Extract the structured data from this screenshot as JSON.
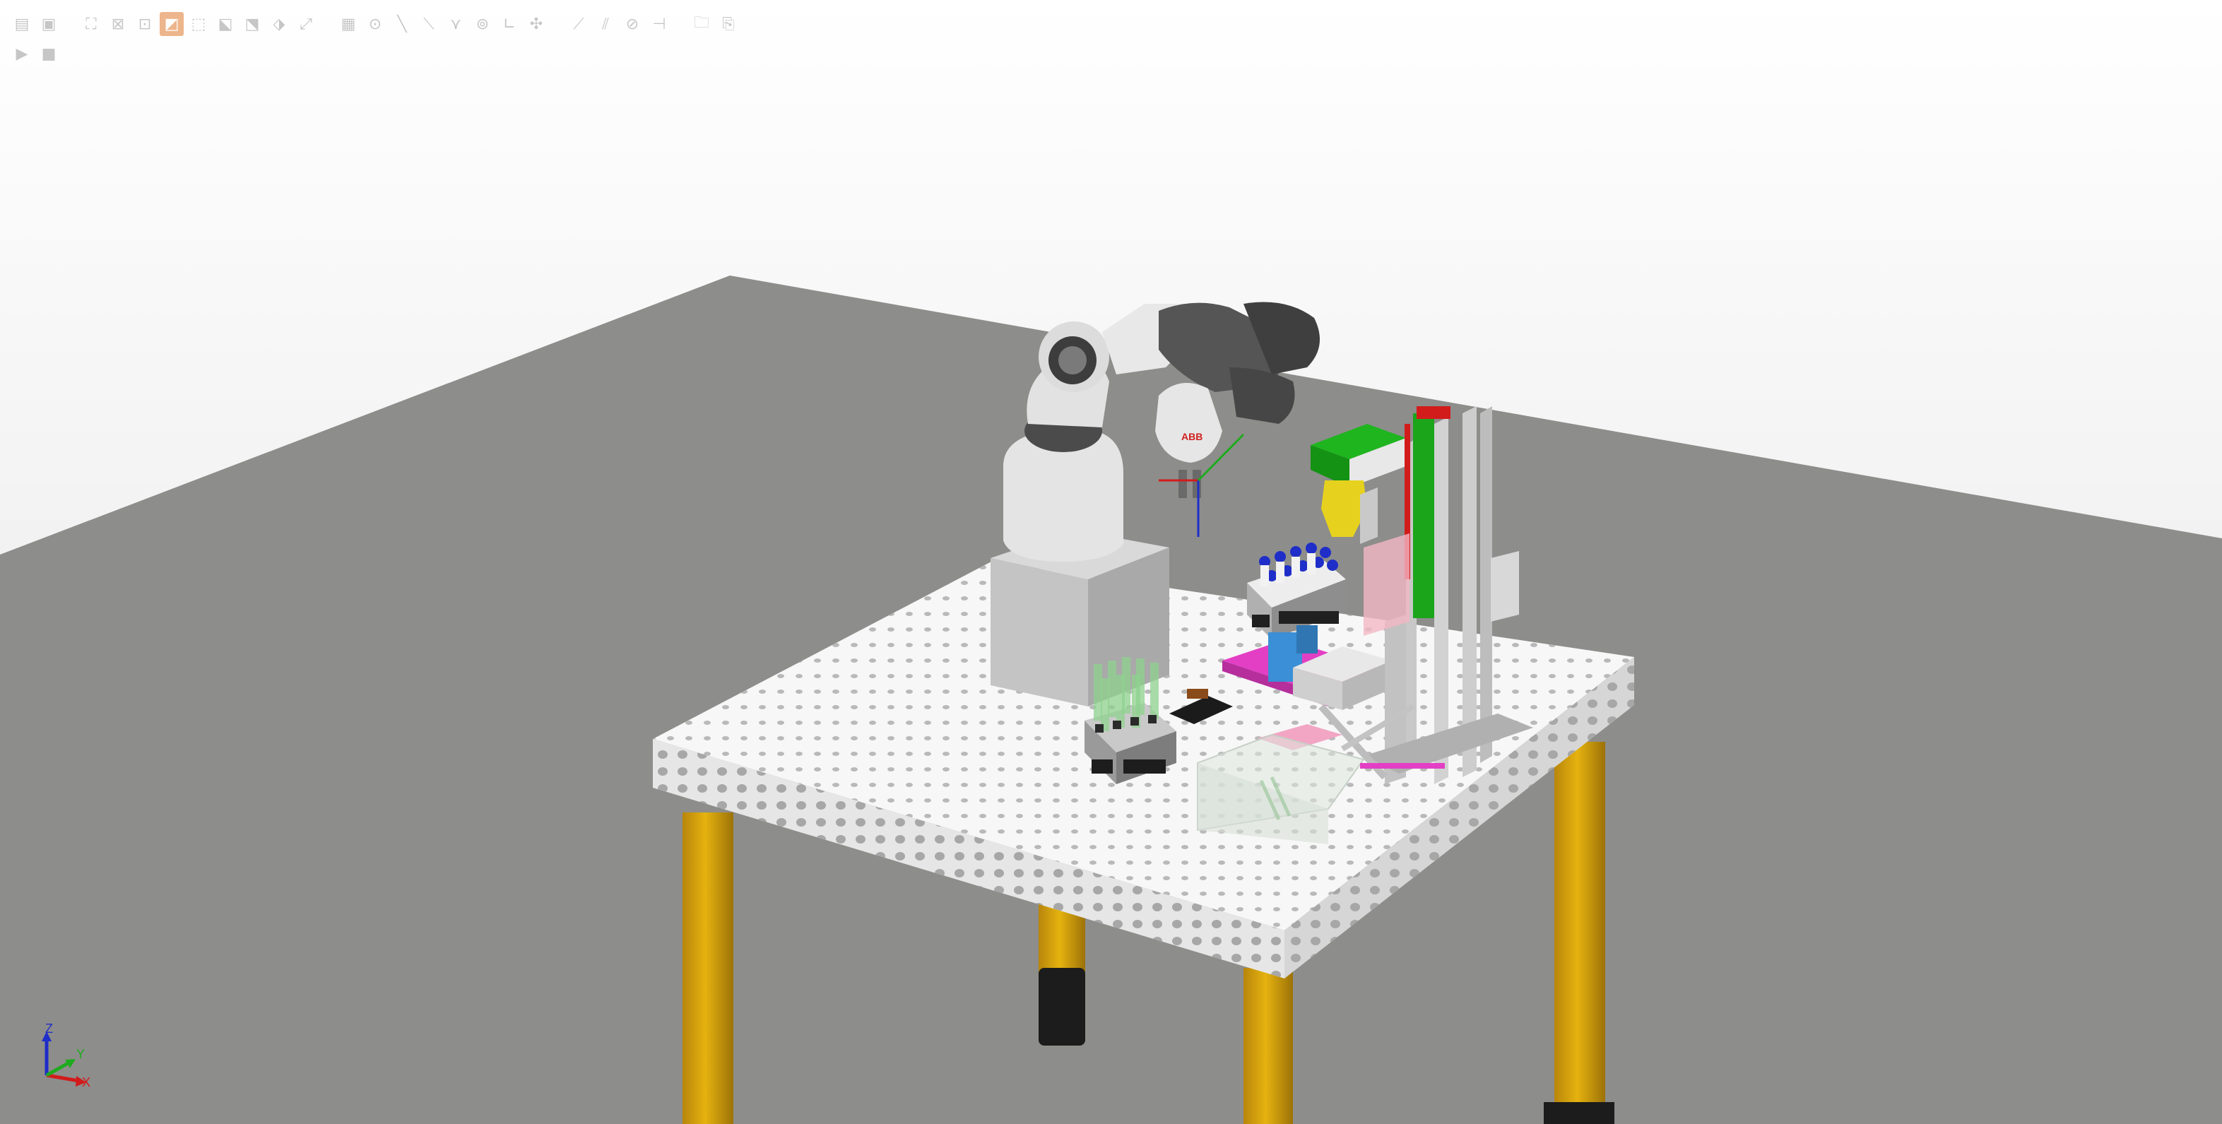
{
  "toolbar": {
    "row1": [
      {
        "icon": "new-file-icon",
        "glyph": "▤"
      },
      {
        "icon": "open-file-icon",
        "glyph": "▣"
      },
      {
        "icon": "zoom-fit-icon",
        "glyph": "⛶"
      },
      {
        "icon": "zoom-window-icon",
        "glyph": "⊠"
      },
      {
        "icon": "zoom-selection-icon",
        "glyph": "⊡"
      },
      {
        "icon": "render-mode-icon",
        "glyph": "◩",
        "active": true
      },
      {
        "icon": "view-front-icon",
        "glyph": "⬚"
      },
      {
        "icon": "view-top-icon",
        "glyph": "⬕"
      },
      {
        "icon": "view-side-icon",
        "glyph": "⬔"
      },
      {
        "icon": "view-iso-icon",
        "glyph": "⬗"
      },
      {
        "icon": "view-custom-icon",
        "glyph": "⤢"
      },
      {
        "icon": "grid-icon",
        "glyph": "▦"
      },
      {
        "icon": "snap-point-icon",
        "glyph": "⊙"
      },
      {
        "icon": "snap-edge-icon",
        "glyph": "╲"
      },
      {
        "icon": "snap-line-icon",
        "glyph": "⟍"
      },
      {
        "icon": "snap-vertex-icon",
        "glyph": "⋎"
      },
      {
        "icon": "snap-center-icon",
        "glyph": "⊚"
      },
      {
        "icon": "measure-angle-icon",
        "glyph": "∟"
      },
      {
        "icon": "move-icon",
        "glyph": "✣"
      },
      {
        "icon": "measure-distance-icon",
        "glyph": "⟋"
      },
      {
        "icon": "measure-chain-icon",
        "glyph": "⫽"
      },
      {
        "icon": "measure-circle-icon",
        "glyph": "⊘"
      },
      {
        "icon": "measure-dimension-icon",
        "glyph": "⊣"
      },
      {
        "icon": "folder-icon",
        "glyph": "🗀"
      },
      {
        "icon": "clipboard-icon",
        "glyph": "⎘"
      }
    ],
    "row2": [
      {
        "icon": "play-icon",
        "glyph": "▶"
      },
      {
        "icon": "stop-icon",
        "glyph": "■"
      }
    ]
  },
  "robot_label": "ABB",
  "axis_triad": {
    "z": "Z",
    "y": "Y",
    "x": "X"
  },
  "colors": {
    "background_top": "#ffffff",
    "background_bottom": "#e6e6e6",
    "floor": "#8c8c8a",
    "table_top": "#fafafa",
    "table_side": "#e3e3e3",
    "table_legs": "#d4a017",
    "robot_white": "#e2e2e2",
    "robot_dark": "#4a4a4a",
    "fixture_green": "#1aa51a",
    "fixture_magenta": "#e33fc4",
    "fixture_blue": "#3a8fd6",
    "vial_caps": "#1f2ec8",
    "gripper_yellow": "#e6d21e"
  }
}
